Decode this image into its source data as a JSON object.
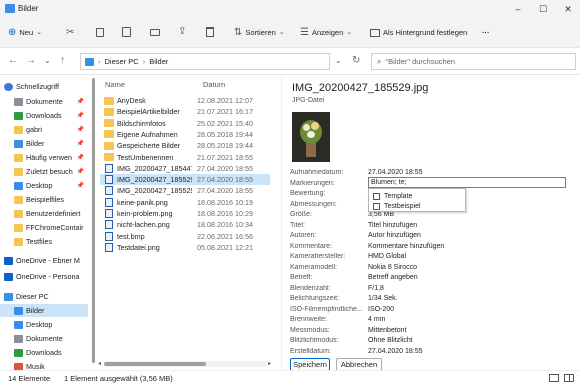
{
  "window": {
    "title": "Bilder"
  },
  "toolbar": {
    "new_label": "Neu",
    "sort_label": "Sortieren",
    "view_label": "Anzeigen",
    "wallpaper_label": "Als Hintergrund festlegen",
    "more_label": "···"
  },
  "nav": {
    "breadcrumb": [
      "Dieser PC",
      "Bilder"
    ],
    "search_placeholder": "\"Bilder\" durchsuchen"
  },
  "sidebar": {
    "items": [
      {
        "label": "Schnellzugriff",
        "icon": "star-icon",
        "color": "#3b78d8",
        "pinned": false
      },
      {
        "label": "Dokumente",
        "icon": "documents-icon",
        "color": "#8a8f9a",
        "pinned": true
      },
      {
        "label": "Downloads",
        "icon": "download-icon",
        "color": "#2a9d3f",
        "pinned": true
      },
      {
        "label": "gabri",
        "icon": "folder-icon",
        "color": "#f5c451",
        "pinned": true
      },
      {
        "label": "Bilder",
        "icon": "pictures-icon",
        "color": "#3b8ee8",
        "pinned": true
      },
      {
        "label": "Häufig verwen",
        "icon": "folder-icon",
        "color": "#f5c451",
        "pinned": true
      },
      {
        "label": "Zuletzt besuch",
        "icon": "folder-icon",
        "color": "#f5c451",
        "pinned": true
      },
      {
        "label": "Desktop",
        "icon": "desktop-icon",
        "color": "#3b8ee8",
        "pinned": true
      },
      {
        "label": "Beispielfiles",
        "icon": "folder-icon",
        "color": "#f5c451",
        "pinned": false
      },
      {
        "label": "Benutzerdefiniert",
        "icon": "folder-icon",
        "color": "#f5c451",
        "pinned": false
      },
      {
        "label": "FFChromeContair",
        "icon": "folder-icon",
        "color": "#f5c451",
        "pinned": false
      },
      {
        "label": "Testfiles",
        "icon": "folder-icon",
        "color": "#f5c451",
        "pinned": false
      },
      {
        "label": "OneDrive - Ebner M",
        "icon": "cloud-icon",
        "color": "#0a64c8",
        "pinned": false
      },
      {
        "label": "OneDrive - Persona",
        "icon": "cloud-icon",
        "color": "#0a64c8",
        "pinned": false
      },
      {
        "label": "Dieser PC",
        "icon": "computer-icon",
        "color": "#3b8ee8",
        "pinned": false
      },
      {
        "label": "Bilder",
        "icon": "pictures-icon",
        "color": "#3b8ee8",
        "pinned": false
      },
      {
        "label": "Desktop",
        "icon": "desktop-icon",
        "color": "#3b8ee8",
        "pinned": false
      },
      {
        "label": "Dokumente",
        "icon": "documents-icon",
        "color": "#8a8f9a",
        "pinned": false
      },
      {
        "label": "Downloads",
        "icon": "download-icon",
        "color": "#2a9d3f",
        "pinned": false
      },
      {
        "label": "Musik",
        "icon": "music-icon",
        "color": "#e0533d",
        "pinned": false
      }
    ]
  },
  "filelist": {
    "col_name": "Name",
    "col_date": "Datum",
    "rows": [
      {
        "name": "AnyDesk",
        "date": "12.08.2021 12:07",
        "kind": "folder"
      },
      {
        "name": "BeispielArtikelbilder",
        "date": "21.07.2021 16:17",
        "kind": "folder"
      },
      {
        "name": "Bildschirmfotos",
        "date": "25.02.2021 15:40",
        "kind": "folder"
      },
      {
        "name": "Eigene Aufnahmen",
        "date": "28.05.2018 19:44",
        "kind": "folder"
      },
      {
        "name": "Gespeicherte Bilder",
        "date": "28.05.2018 19:44",
        "kind": "folder"
      },
      {
        "name": "TestUmbenennen",
        "date": "21.07.2021 18:55",
        "kind": "folder"
      },
      {
        "name": "IMG_20200427_185447...",
        "date": "27.04.2020 18:55",
        "kind": "file"
      },
      {
        "name": "IMG_20200427_185529...",
        "date": "27.04.2020 18:55",
        "kind": "file"
      },
      {
        "name": "IMG_20200427_185529...",
        "date": "27.04.2020 18:55",
        "kind": "file"
      },
      {
        "name": "keine-panik.png",
        "date": "18.08.2016 10:19",
        "kind": "file"
      },
      {
        "name": "kein-problem.png",
        "date": "18.08.2016 10:29",
        "kind": "file"
      },
      {
        "name": "nicht-lachen.png",
        "date": "18.08.2016 10:34",
        "kind": "file"
      },
      {
        "name": "test.bmp",
        "date": "22.06.2021 16:56",
        "kind": "file"
      },
      {
        "name": "Testdatei.png",
        "date": "05.08.2021 12:21",
        "kind": "file"
      }
    ]
  },
  "details": {
    "filename": "IMG_20200427_185529.jpg",
    "filetype": "JPG-Datei",
    "tag_value": "Blumen; te;",
    "tag_suggestions": [
      "Template",
      "Testbeispiel"
    ],
    "properties": [
      {
        "label": "Aufnahmedatum:",
        "value": "27.04.2020 18:55"
      },
      {
        "label": "Markierungen:",
        "value": ""
      },
      {
        "label": "Bewertung:",
        "value": ""
      },
      {
        "label": "Abmessungen:",
        "value": ""
      },
      {
        "label": "Größe:",
        "value": "3,56 MB"
      },
      {
        "label": "Titel:",
        "value": "Titel hinzufügen"
      },
      {
        "label": "Autoren:",
        "value": "Autor hinzufügen"
      },
      {
        "label": "Kommentare:",
        "value": "Kommentare hinzufügen"
      },
      {
        "label": "Kamerahersteller:",
        "value": "HMD Global"
      },
      {
        "label": "Kameramodell:",
        "value": "Nokia 8 Sirocco"
      },
      {
        "label": "Betreff:",
        "value": "Betreff angeben"
      },
      {
        "label": "Blendenzahl:",
        "value": "F/1,8"
      },
      {
        "label": "Belichtungszeit:",
        "value": "1/34 Sek."
      },
      {
        "label": "ISO-Filmempfindliche...",
        "value": "ISO-200"
      },
      {
        "label": "Brennweite:",
        "value": "4 mm"
      },
      {
        "label": "Messmodus:",
        "value": "Mittenbetont"
      },
      {
        "label": "Blitzlichtmodus:",
        "value": "Ohne Blitzlicht"
      },
      {
        "label": "Erstelldatum:",
        "value": "27.04.2020 18:55"
      }
    ],
    "save_label": "Speichern",
    "cancel_label": "Abbrechen"
  },
  "status": {
    "count": "14 Elemente",
    "selection": "1 Element ausgewählt (3,56 MB)"
  },
  "colors": {
    "accent": "#0067c0",
    "selection": "#cce4f7",
    "folder": "#f5c451"
  }
}
